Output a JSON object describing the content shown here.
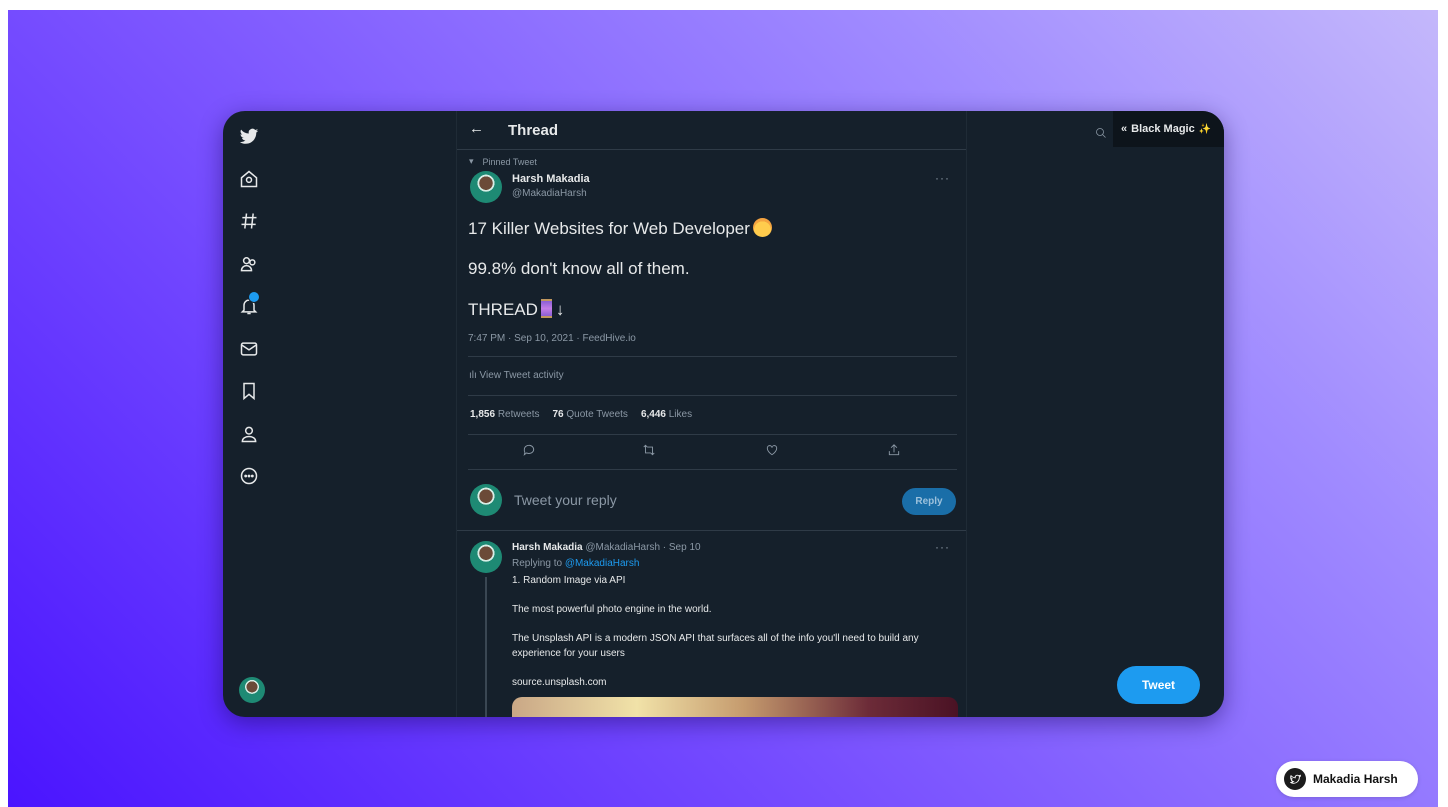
{
  "header": {
    "back": "←",
    "title": "Thread"
  },
  "pinned": {
    "glyph": "📌",
    "label": "Pinned Tweet"
  },
  "tweet": {
    "author_name": "Harsh Makadia",
    "author_handle": "@MakadiaHarsh",
    "more": "···",
    "line1": "17 Killer Websites for Web Developer",
    "line2": "99.8% don't know all of them.",
    "line3_text": "THREAD",
    "line3_arrow": "↓",
    "meta": "7:47 PM · Sep 10, 2021 · FeedHive.io",
    "activity": "ılı View Tweet activity",
    "stats": {
      "retweets_count": "1,856",
      "retweets_label": "Retweets",
      "quotes_count": "76",
      "quotes_label": "Quote Tweets",
      "likes_count": "6,446",
      "likes_label": "Likes"
    }
  },
  "reply_box": {
    "placeholder": "Tweet your reply",
    "button": "Reply"
  },
  "reply": {
    "author_name": "Harsh Makadia",
    "handle_time": "@MakadiaHarsh · Sep 10",
    "replying_prefix": "Replying to",
    "replying_handle": "@MakadiaHarsh",
    "more": "···",
    "line1": "1. Random Image via API",
    "line2": "The most powerful photo engine in the world.",
    "line3": "The Unsplash API is a modern JSON API that surfaces all of the info you'll need to build any experience for your users",
    "link": "source.unsplash.com"
  },
  "extension": {
    "chevron": "«",
    "label": "Black Magic",
    "sparkle": "✨"
  },
  "tweet_button": "Tweet",
  "watermark": {
    "name": "Makadia Harsh"
  },
  "nav": {
    "icons": [
      "twitter-logo",
      "home-icon",
      "explore-icon",
      "communities-icon",
      "notifications-icon",
      "messages-icon",
      "bookmarks-icon",
      "profile-icon",
      "more-icon"
    ]
  },
  "colors": {
    "background": "#15202b",
    "accent": "#1d9bf0",
    "text": "#e7e9ea",
    "muted": "#8b98a5"
  }
}
